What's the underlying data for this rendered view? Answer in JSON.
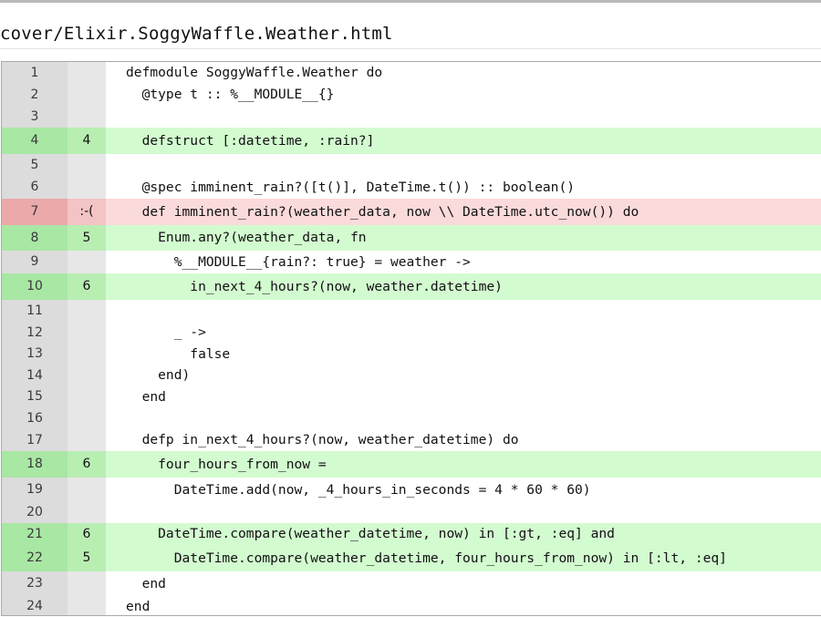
{
  "file": {
    "title": "cover/Elixir.SoggyWaffle.Weather.html"
  },
  "colors": {
    "covered": "#d3fbd0",
    "missed": "#fbdadb",
    "neutral": "#ffffff",
    "gutter": "#dcdcdc"
  },
  "lines": [
    {
      "num": "1",
      "hits": "",
      "status": "never",
      "code": "defmodule SoggyWaffle.Weather do"
    },
    {
      "num": "2",
      "hits": "",
      "status": "never",
      "code": "  @type t :: %__MODULE__{}"
    },
    {
      "num": "3",
      "hits": "",
      "status": "never",
      "code": ""
    },
    {
      "num": "4",
      "hits": "4",
      "status": "covered",
      "code": "  defstruct [:datetime, :rain?]"
    },
    {
      "num": "5",
      "hits": "",
      "status": "never",
      "code": ""
    },
    {
      "num": "6",
      "hits": "",
      "status": "never",
      "code": "  @spec imminent_rain?([t()], DateTime.t()) :: boolean()"
    },
    {
      "num": "7",
      "hits": ":-(",
      "status": "missed",
      "code": "  def imminent_rain?(weather_data, now \\\\ DateTime.utc_now()) do"
    },
    {
      "num": "8",
      "hits": "5",
      "status": "covered",
      "code": "    Enum.any?(weather_data, fn"
    },
    {
      "num": "9",
      "hits": "",
      "status": "never",
      "code": "      %__MODULE__{rain?: true} = weather ->"
    },
    {
      "num": "10",
      "hits": "6",
      "status": "covered",
      "code": "        in_next_4_hours?(now, weather.datetime)"
    },
    {
      "num": "11",
      "hits": "",
      "status": "never",
      "code": ""
    },
    {
      "num": "12",
      "hits": "",
      "status": "never",
      "code": "      _ ->"
    },
    {
      "num": "13",
      "hits": "",
      "status": "never",
      "code": "        false"
    },
    {
      "num": "14",
      "hits": "",
      "status": "never",
      "code": "    end)"
    },
    {
      "num": "15",
      "hits": "",
      "status": "never",
      "code": "  end"
    },
    {
      "num": "16",
      "hits": "",
      "status": "never",
      "code": ""
    },
    {
      "num": "17",
      "hits": "",
      "status": "never",
      "code": "  defp in_next_4_hours?(now, weather_datetime) do"
    },
    {
      "num": "18",
      "hits": "6",
      "status": "covered",
      "code": "    four_hours_from_now ="
    },
    {
      "num": "19",
      "hits": "",
      "status": "never",
      "code": "      DateTime.add(now, _4_hours_in_seconds = 4 * 60 * 60)"
    },
    {
      "num": "20",
      "hits": "",
      "status": "never",
      "code": ""
    },
    {
      "num": "21",
      "hits": "6",
      "status": "covered",
      "code": "    DateTime.compare(weather_datetime, now) in [:gt, :eq] and"
    },
    {
      "num": "22",
      "hits": "5",
      "status": "covered",
      "code": "      DateTime.compare(weather_datetime, four_hours_from_now) in [:lt, :eq]"
    },
    {
      "num": "23",
      "hits": "",
      "status": "never",
      "code": "  end"
    },
    {
      "num": "24",
      "hits": "",
      "status": "never",
      "code": "end"
    }
  ]
}
